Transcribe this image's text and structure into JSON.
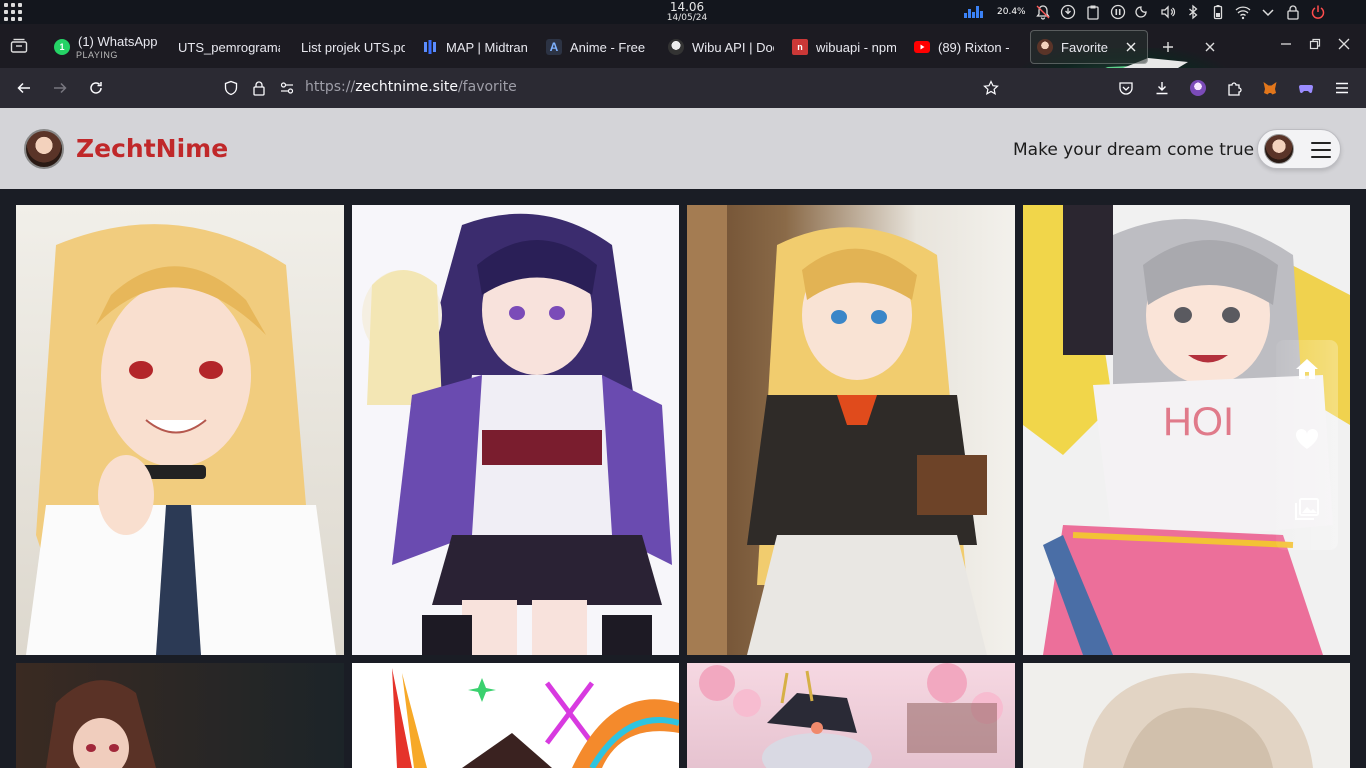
{
  "system": {
    "time": "14.06",
    "date": "14/05/24",
    "cpu_percent": "20.4%"
  },
  "tabs": [
    {
      "label": "(1) WhatsApp",
      "sub": "PLAYING",
      "favicon": "whatsapp-icon",
      "badge": "1"
    },
    {
      "label": "UTS_pemrograman",
      "favicon": "none"
    },
    {
      "label": "List projek UTS.pdf",
      "favicon": "none"
    },
    {
      "label": "MAP | Midtrans",
      "favicon": "midtrans-icon"
    },
    {
      "label": "Anime - Free",
      "favicon": "anime-icon"
    },
    {
      "label": "Wibu API | Docs",
      "favicon": "wibu-avatar-icon"
    },
    {
      "label": "wibuapi - npm",
      "favicon": "npm-icon"
    },
    {
      "label": "(89) Rixton -",
      "favicon": "youtube-icon"
    },
    {
      "label": "Favorite",
      "favicon": "zechtnime-avatar-icon",
      "active": true
    }
  ],
  "address": {
    "scheme": "https://",
    "host": "zechtnime.site",
    "path": "/favorite"
  },
  "site": {
    "brand": "ZechtNime",
    "tagline": "Make your dream come true",
    "brand_color": "#c0282a",
    "header_bg": "#d4d4d8"
  },
  "gallery": {
    "images": [
      {
        "name": "blonde-girl-white-shirt"
      },
      {
        "name": "purple-hair-maid"
      },
      {
        "name": "blonde-girl-library"
      },
      {
        "name": "gray-hair-cheerleader"
      },
      {
        "name": "brown-hair-girl"
      },
      {
        "name": "colorful-splash-art"
      },
      {
        "name": "sakura-white-hair-girl"
      },
      {
        "name": "pale-hair-girl"
      }
    ]
  },
  "floating_nav": [
    "home-icon",
    "heart-icon",
    "gallery-icon"
  ]
}
